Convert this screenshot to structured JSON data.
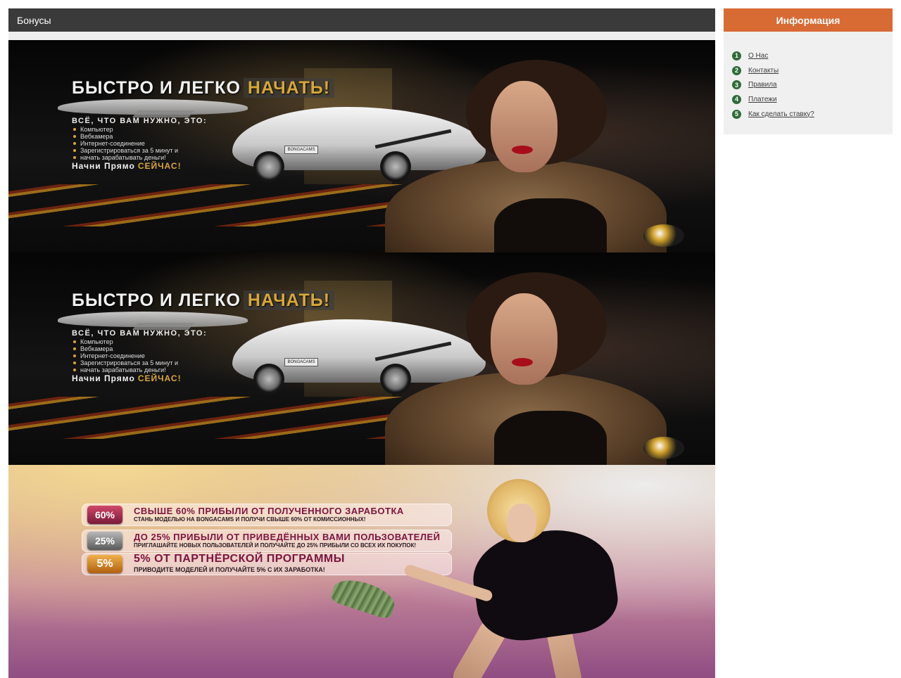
{
  "main": {
    "title": "Бонусы"
  },
  "sidebar": {
    "title": "Информация",
    "items": [
      {
        "num": "1",
        "label": "О Нас"
      },
      {
        "num": "2",
        "label": "Контакты"
      },
      {
        "num": "3",
        "label": "Правила"
      },
      {
        "num": "4",
        "label": "Платежи"
      },
      {
        "num": "5",
        "label": "Как сделать ставку?"
      }
    ]
  },
  "banner_start": {
    "title": "БЫСТРО И ЛЕГКО",
    "title_accent": "НАЧАТЬ!",
    "subtitle": "ВСЁ, ЧТО ВАМ НУЖНО, ЭТО:",
    "list": [
      "Компьютер",
      "Вебкамера",
      "Интернет-соединение",
      "Зарегистрироваться за 5 минут и",
      "начать зарабатывать деньги!"
    ],
    "cta": "Начни Прямо",
    "cta_accent": "СЕЙЧАС!",
    "plate": "BONGACAMS"
  },
  "banner_offers": {
    "offers": [
      {
        "badge": "60%",
        "head": "СВЫШЕ 60% ПРИБЫЛИ ОТ ПОЛУЧЕННОГО ЗАРАБОТКА",
        "sub": "СТАНЬ МОДЕЛЬЮ НА BONGACAMS И ПОЛУЧИ СВЫШЕ 60% ОТ КОМИССИОННЫХ!"
      },
      {
        "badge": "25%",
        "head": "ДО 25% ПРИБЫЛИ ОТ ПРИВЕДЁННЫХ ВАМИ ПОЛЬЗОВАТЕЛЕЙ",
        "sub": "ПРИГЛАШАЙТЕ НОВЫХ ПОЛЬЗОВАТЕЛЕЙ И ПОЛУЧАЙТЕ ДО 25% ПРИБЫЛИ СО ВСЕХ ИХ ПОКУПОК!"
      },
      {
        "badge": "5%",
        "head": "5% ОТ ПАРТНЁРСКОЙ ПРОГРАММЫ",
        "sub": "ПРИВОДИТЕ МОДЕЛЕЙ И ПОЛУЧАЙТЕ 5% С ИХ ЗАРАБОТКА!"
      }
    ]
  },
  "colors": {
    "header_dark": "#3a3a3a",
    "sidebar_accent": "#d86a34",
    "number_icon": "#2f6b3a",
    "gold_accent": "#d9a737"
  }
}
